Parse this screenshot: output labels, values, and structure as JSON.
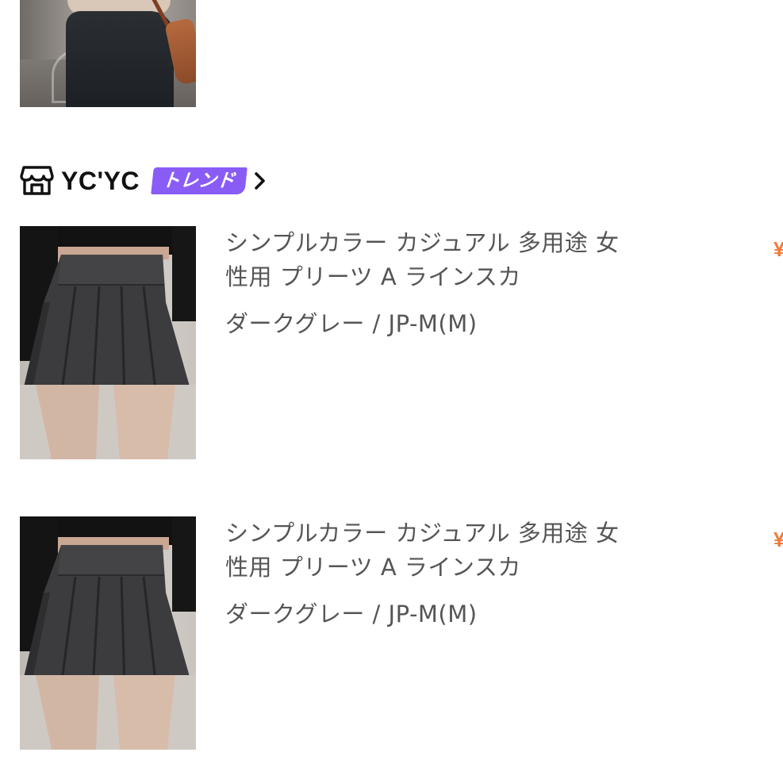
{
  "store": {
    "name": "YC'YC",
    "badge": "トレンド",
    "icon": "store-icon",
    "chevron_icon": "chevron-right-icon",
    "badge_color": "#8a5cf6"
  },
  "items": [
    {
      "title": "シンプルカラー カジュアル 多用途 女性用 プリーツ A ラインスカ",
      "variant": "ダークグレー / JP-M(M)",
      "price_prefix": "¥"
    },
    {
      "title": "シンプルカラー カジュアル 多用途 女性用 プリーツ A ラインスカ",
      "variant": "ダークグレー / JP-M(M)",
      "price_prefix": "¥"
    }
  ],
  "colors": {
    "text_secondary": "#555555",
    "price": "#f27a3c"
  }
}
